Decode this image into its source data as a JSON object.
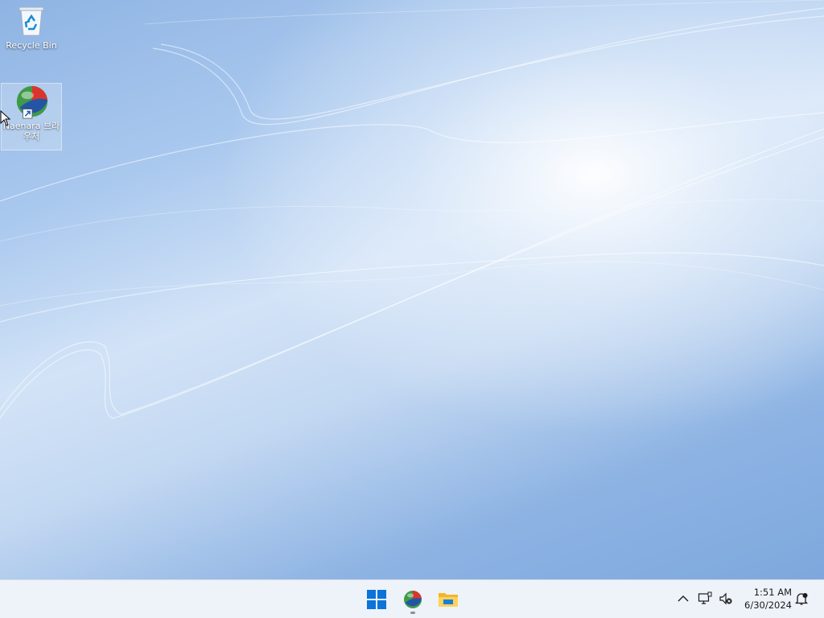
{
  "desktop": {
    "icons": [
      {
        "label": "Recycle Bin",
        "icon": "recycle-bin-icon"
      },
      {
        "label": "Naenara 브라우저",
        "icon": "naenara-browser-icon",
        "selected": true,
        "shortcut": true
      }
    ]
  },
  "taskbar": {
    "pinned": [
      {
        "name": "Start",
        "icon": "windows-logo-icon"
      },
      {
        "name": "Naenara Browser",
        "icon": "naenara-browser-icon",
        "running": true
      },
      {
        "name": "File Explorer",
        "icon": "folder-icon"
      }
    ],
    "tray": {
      "chevron_icon": "chevron-up-icon",
      "network_icon": "network-disconnected-icon",
      "volume_icon": "volume-muted-icon",
      "time": "1:51 AM",
      "date": "6/30/2024",
      "notification_icon": "notification-bell-icon"
    }
  },
  "colors": {
    "wallpaper_base": "#9fc1ea",
    "taskbar_bg": "#eef2f9",
    "accent": "#0078d4"
  }
}
